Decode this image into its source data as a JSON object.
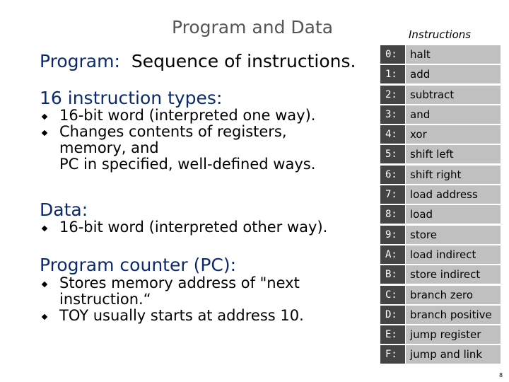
{
  "slide": {
    "title": "Program and Data",
    "program": {
      "heading": "Program:",
      "text": "Sequence of instructions."
    },
    "types": {
      "heading": "16 instruction types:",
      "bullets": [
        "16-bit word (interpreted one way).",
        "Changes contents of registers,",
        "memory, and",
        "PC in specified, well-defined ways."
      ]
    },
    "data": {
      "heading": "Data:",
      "bullets": [
        "16-bit word (interpreted other way)."
      ]
    },
    "pc": {
      "heading": "Program counter (PC):",
      "bullets": [
        "Stores memory address of \"next",
        "instruction.“",
        "TOY usually starts at address 10."
      ]
    },
    "page_number": "8"
  },
  "instructions": {
    "heading": "Instructions",
    "rows": [
      {
        "code": "0:",
        "name": "halt"
      },
      {
        "code": "1:",
        "name": "add"
      },
      {
        "code": "2:",
        "name": "subtract"
      },
      {
        "code": "3:",
        "name": "and"
      },
      {
        "code": "4:",
        "name": "xor"
      },
      {
        "code": "5:",
        "name": "shift left"
      },
      {
        "code": "6:",
        "name": "shift right"
      },
      {
        "code": "7:",
        "name": "load address"
      },
      {
        "code": "8:",
        "name": "load"
      },
      {
        "code": "9:",
        "name": "store"
      },
      {
        "code": "A:",
        "name": "load indirect"
      },
      {
        "code": "B:",
        "name": "store indirect"
      },
      {
        "code": "C:",
        "name": "branch zero"
      },
      {
        "code": "D:",
        "name": "branch positive"
      },
      {
        "code": "E:",
        "name": "jump register"
      },
      {
        "code": "F:",
        "name": "jump and link"
      }
    ]
  }
}
